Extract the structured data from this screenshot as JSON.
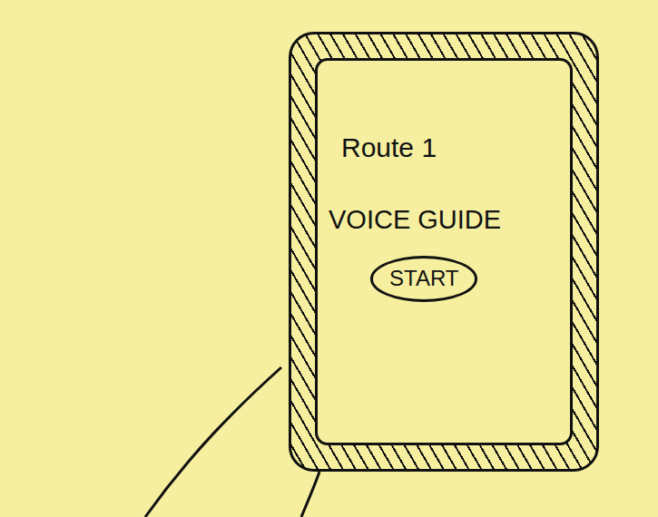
{
  "screen": {
    "title": "Route 1",
    "subtitle": "VOICE GUIDE",
    "button": "START"
  }
}
